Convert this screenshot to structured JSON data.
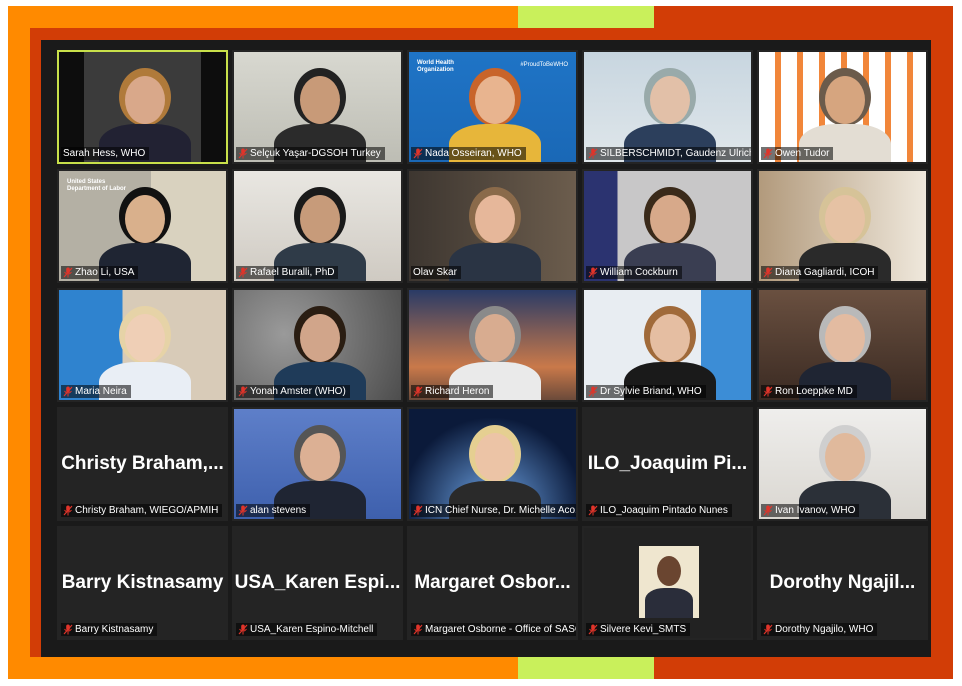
{
  "meeting": {
    "participants": [
      {
        "name": "Sarah Hess, WHO",
        "muted": false,
        "video": true
      },
      {
        "name": "Selçuk Yaşar-DGSOH Turkey",
        "muted": true,
        "video": true
      },
      {
        "name": "Nada Osseiran, WHO",
        "muted": true,
        "video": true,
        "background_text": "World Health Organization",
        "background_tag": "#ProudToBeWHO"
      },
      {
        "name": "SILBERSCHMIDT, Gaudenz Ulrich",
        "muted": true,
        "video": true
      },
      {
        "name": "Owen Tudor",
        "muted": true,
        "video": true
      },
      {
        "name": "Zhao Li, USA",
        "muted": true,
        "video": true,
        "background_text": "United States Department of Labor"
      },
      {
        "name": "Rafael Buralli, PhD",
        "muted": true,
        "video": true
      },
      {
        "name": "Olav Skar",
        "muted": false,
        "video": true
      },
      {
        "name": "William Cockburn",
        "muted": true,
        "video": true
      },
      {
        "name": "Diana Gagliardi, ICOH",
        "muted": true,
        "video": true
      },
      {
        "name": "Maria Neira",
        "muted": true,
        "video": true
      },
      {
        "name": "Yonah Amster (WHO)",
        "muted": true,
        "video": true
      },
      {
        "name": "Richard Heron",
        "muted": true,
        "video": true
      },
      {
        "name": "Dr Sylvie Briand, WHO",
        "muted": true,
        "video": true
      },
      {
        "name": "Ron Loeppke MD",
        "muted": true,
        "video": true
      },
      {
        "name": "Christy Braham, WIEGO/APMIH",
        "muted": true,
        "video": false,
        "display_name": "Christy Braham,..."
      },
      {
        "name": "alan stevens",
        "muted": true,
        "video": true
      },
      {
        "name": "ICN Chief Nurse, Dr. Michelle Aco...",
        "muted": true,
        "video": true
      },
      {
        "name": "ILO_Joaquim Pintado Nunes",
        "muted": true,
        "video": false,
        "display_name": "ILO_Joaquim Pi..."
      },
      {
        "name": "Ivan Ivanov, WHO",
        "muted": true,
        "video": true
      },
      {
        "name": "Barry Kistnasamy",
        "muted": true,
        "video": false,
        "display_name": "Barry Kistnasamy"
      },
      {
        "name": "USA_Karen Espino-Mitchell",
        "muted": true,
        "video": false,
        "display_name": "USA_Karen Espi..."
      },
      {
        "name": "Margaret Osborne - Office of SASG",
        "muted": true,
        "video": false,
        "display_name": "Margaret Osbor..."
      },
      {
        "name": "Silvere Kevi_SMTS",
        "muted": true,
        "video": true
      },
      {
        "name": "Dorothy Ngajilo, WHO",
        "muted": true,
        "video": false,
        "display_name": "Dorothy Ngajil..."
      }
    ]
  },
  "colors": {
    "frame_red": "#d23d06",
    "frame_orange": "#ff8a00",
    "frame_lime": "#c9f05b",
    "active_speaker": "#c8e04a",
    "meeting_bg": "#1a1a1a",
    "muted_icon": "#e0342a"
  }
}
